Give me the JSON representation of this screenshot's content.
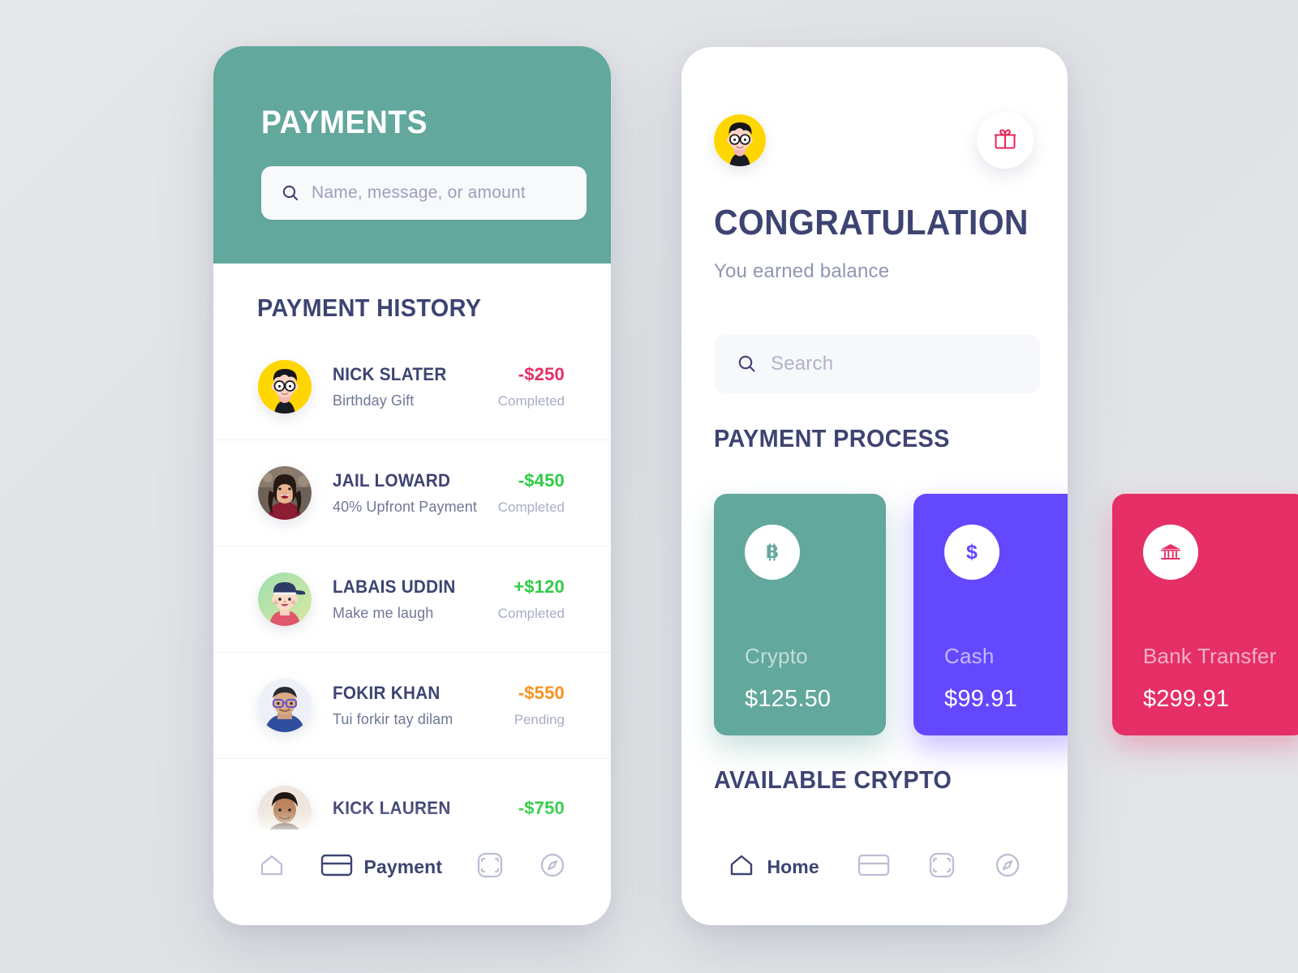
{
  "theme": {
    "teal": "#62A89C",
    "purple": "#6348FE",
    "crimson": "#E52F66",
    "navy": "#3D4472",
    "green": "#2ECC45",
    "orange": "#F79220",
    "page_bg": "#E2E4E7"
  },
  "left_phone": {
    "header": {
      "title": "PAYMENTS",
      "search": {
        "icon": "search-icon",
        "placeholder": "Name, message, or amount",
        "value": ""
      }
    },
    "history": {
      "title": "PAYMENT HISTORY",
      "rows": [
        {
          "name": "NICK SLATER",
          "note": "Birthday Gift",
          "amount": "-$250",
          "amount_color": "#E52F66",
          "status": "Completed",
          "avatar": "avatar-illustration-yellow"
        },
        {
          "name": "JAIL LOWARD",
          "note": "40% Upfront Payment",
          "amount": "-$450",
          "amount_color": "#2ECC45",
          "status": "Completed",
          "avatar": "avatar-photo-woman"
        },
        {
          "name": "LABAIS UDDIN",
          "note": "Make me laugh",
          "amount": "+$120",
          "amount_color": "#2ECC45",
          "status": "Completed",
          "avatar": "avatar-illustration-green"
        },
        {
          "name": "FOKIR KHAN",
          "note": "Tui forkir tay dilam",
          "amount": "-$550",
          "amount_color": "#F79220",
          "status": "Pending",
          "avatar": "avatar-photo-man-glasses"
        },
        {
          "name": "KICK LAUREN",
          "note": "",
          "amount": "-$750",
          "amount_color": "#2ECC45",
          "status": "",
          "avatar": "avatar-photo-man"
        }
      ]
    },
    "nav": {
      "items": [
        {
          "icon": "home-icon",
          "label": "",
          "active": false
        },
        {
          "icon": "credit-card-icon",
          "label": "Payment",
          "active": true
        },
        {
          "icon": "scan-icon",
          "label": "",
          "active": false
        },
        {
          "icon": "compass-icon",
          "label": "",
          "active": false
        }
      ]
    }
  },
  "right_phone": {
    "header": {
      "avatar": "avatar-illustration-yellow",
      "gift_button": "gift-icon"
    },
    "title": "CONGRATULATION",
    "subtitle": "You earned balance",
    "search": {
      "icon": "search-icon",
      "placeholder": "Search",
      "value": ""
    },
    "process": {
      "title": "PAYMENT PROCESS",
      "cards": [
        {
          "icon": "bitcoin-icon",
          "label": "Crypto",
          "amount": "$125.50",
          "color": "#62A89C"
        },
        {
          "icon": "dollar-icon",
          "label": "Cash",
          "amount": "$99.91",
          "color": "#6348FE"
        },
        {
          "icon": "bank-icon",
          "label": "Bank Transfer",
          "amount": "$299.91",
          "color": "#E52F66"
        }
      ]
    },
    "available_crypto_title": "AVAILABLE CRYPTO",
    "nav": {
      "items": [
        {
          "icon": "home-icon",
          "label": "Home",
          "active": true
        },
        {
          "icon": "credit-card-icon",
          "label": "",
          "active": false
        },
        {
          "icon": "scan-icon",
          "label": "",
          "active": false
        },
        {
          "icon": "compass-icon",
          "label": "",
          "active": false
        }
      ]
    }
  }
}
